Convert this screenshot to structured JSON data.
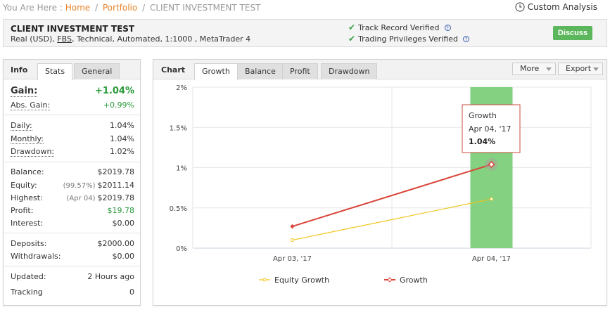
{
  "breadcrumb": {
    "prefix": "You Are Here :",
    "home": "Home",
    "portfolio": "Portfolio",
    "current": "CLIENT INVESTMENT TEST"
  },
  "custom_analysis": {
    "label": "Custom Analysis",
    "icon": "clock-icon"
  },
  "account": {
    "name": "CLIENT INVESTMENT TEST",
    "meta_before": "Real (USD), ",
    "broker": "FBS",
    "meta_after": ", Technical, Automated, 1:1000 , MetaTrader 4"
  },
  "verification": {
    "track_record": "Track Record Verified",
    "trading_privileges": "Trading Privileges Verified"
  },
  "discuss_label": "Discuss",
  "info_panel": {
    "title": "Info",
    "tabs": [
      "Stats",
      "General"
    ],
    "active_tab": "Stats",
    "gain": {
      "label": "Gain:",
      "value": "+1.04%"
    },
    "abs_gain": {
      "label": "Abs. Gain:",
      "value": "+0.99%"
    },
    "daily": {
      "label": "Daily:",
      "value": "1.04%"
    },
    "monthly": {
      "label": "Monthly:",
      "value": "1.04%"
    },
    "drawdown": {
      "label": "Drawdown:",
      "value": "1.02%"
    },
    "balance": {
      "label": "Balance:",
      "value": "$2019.78"
    },
    "equity": {
      "label": "Equity:",
      "note": "(99.57%)",
      "value": "$2011.14"
    },
    "highest": {
      "label": "Highest:",
      "note": "(Apr 04)",
      "value": "$2019.78"
    },
    "profit": {
      "label": "Profit:",
      "value": "$19.78"
    },
    "interest": {
      "label": "Interest:",
      "value": "$0.00"
    },
    "deposits": {
      "label": "Deposits:",
      "value": "$2000.00"
    },
    "withdrawals": {
      "label": "Withdrawals:",
      "value": "$0.00"
    },
    "updated": {
      "label": "Updated:",
      "value": "2 Hours ago"
    },
    "tracking": {
      "label": "Tracking",
      "value": "0"
    }
  },
  "chart_panel": {
    "title": "Chart",
    "tabs": [
      "Growth",
      "Balance",
      "Profit",
      "Drawdown"
    ],
    "active_tab": "Growth",
    "more_label": "More",
    "export_label": "Export"
  },
  "tooltip": {
    "title": "Growth",
    "date": "Apr 04, '17",
    "value": "1.04%"
  },
  "colors": {
    "growth": "#d9453a",
    "equity_growth": "#f0c419",
    "highlight_bar": "#7ccf7a",
    "accent": "#e8832a",
    "positive": "#2a9a3a"
  },
  "chart_data": {
    "type": "line",
    "categories": [
      "Apr 03, '17",
      "Apr 04, '17"
    ],
    "series": [
      {
        "name": "Equity Growth",
        "values": [
          0.1,
          0.61
        ],
        "color": "#f0c419"
      },
      {
        "name": "Growth",
        "values": [
          0.27,
          1.04
        ],
        "color": "#d9453a"
      }
    ],
    "highlight_category": "Apr 04, '17",
    "yticks": [
      "0%",
      "0.5%",
      "1%",
      "1.5%",
      "2%"
    ],
    "ylim": [
      0,
      2
    ],
    "grid": true,
    "legend_position": "bottom"
  }
}
